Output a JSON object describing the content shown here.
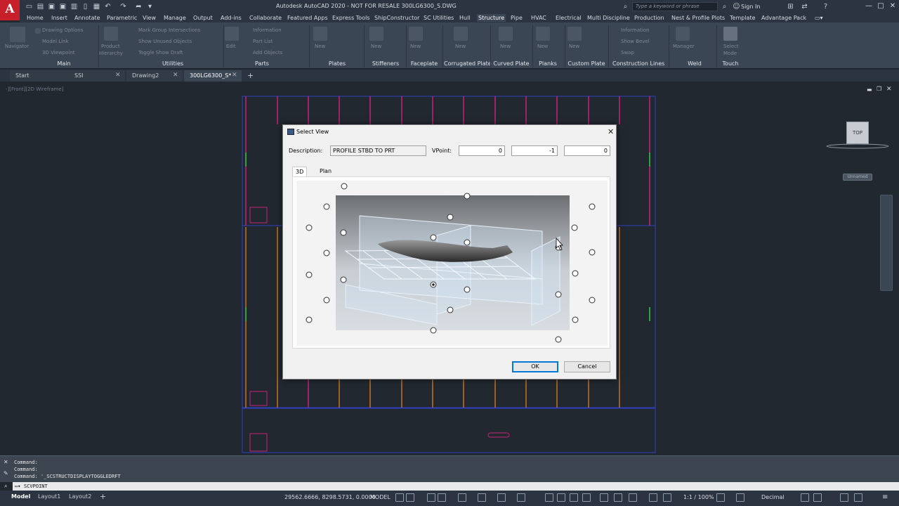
{
  "app": {
    "window_title": "Autodesk AutoCAD 2020 - NOT FOR RESALE   300LG6300_S.DWG",
    "search_placeholder": "Type a keyword or phrase",
    "sign_in": "Sign In",
    "logo_letter": "A"
  },
  "menu": {
    "tabs": [
      "Home",
      "Insert",
      "Annotate",
      "Parametric",
      "View",
      "Manage",
      "Output",
      "Add-ins",
      "Collaborate",
      "Featured Apps",
      "Express Tools",
      "ShipConstructor",
      "SC Utilities",
      "Hull",
      "Structure",
      "Pipe",
      "HVAC",
      "Electrical",
      "Multi Discipline",
      "Production",
      "Nest & Profile Plots",
      "Template",
      "Advantage Pack"
    ],
    "active": "Structure"
  },
  "ribbon": {
    "panels": [
      "Main",
      "Utilities",
      "Parts",
      "Plates",
      "Stiffeners",
      "Faceplate",
      "Corrugated Plate",
      "Curved Plate",
      "Planks",
      "Custom Plate",
      "Construction Lines",
      "Weld",
      "Touch"
    ],
    "items": {
      "navigator": "Navigator",
      "product_hierarchy_1": "Product",
      "product_hierarchy_2": "Hierarchy",
      "drawing_options": "Drawing Options",
      "model_link": "Model Link",
      "viewpoint_3d": "3D Viewpoint",
      "mark_group": "Mark Group Intersections",
      "show_unused": "Show Unused Objects",
      "toggle_draft": "Toggle Show Draft",
      "information": "Information",
      "part_list": "Part List",
      "add_objects": "Add Objects",
      "new": "New",
      "edit": "Edit",
      "information2": "Information",
      "show_bevel": "Show Bevel",
      "swap": "Swap",
      "manager": "Manager",
      "select_mode_1": "Select",
      "select_mode_2": "Mode"
    }
  },
  "file_tabs": {
    "tabs": [
      "Start",
      "SSI",
      "Drawing2",
      "300LG6300_S*"
    ],
    "active": "300LG6300_S*"
  },
  "canvas": {
    "view_label": "-][Front][2D Wireframe]",
    "viewcube_face": "TOP",
    "ucs_name": "Unnamed"
  },
  "dialog": {
    "title": "Select View",
    "description_label": "Description:",
    "description_value": "PROFILE STBD TO PRT",
    "vpoint_label": "VPoint:",
    "vpoint_x": "0",
    "vpoint_y": "-1",
    "vpoint_z": "0",
    "tabs": [
      "3D",
      "Plan"
    ],
    "active_tab": "3D",
    "ok": "OK",
    "cancel": "Cancel"
  },
  "command": {
    "history": [
      "Command:",
      "Command:",
      "Command: '_SCSTRUCTDISPLAYTOGGLEDRFT"
    ],
    "input": "SCVPOINT"
  },
  "status": {
    "layout_tabs": [
      "Model",
      "Layout1",
      "Layout2"
    ],
    "active_layout": "Model",
    "coords": "29562.6666, 8298.5731, 0.0000",
    "model": "MODEL",
    "scale": "1:1 / 100%",
    "units": "Decimal"
  },
  "colors": {
    "frame_magenta": "#c8207a",
    "frame_orange": "#c87020",
    "frame_blue": "#3040c0"
  }
}
